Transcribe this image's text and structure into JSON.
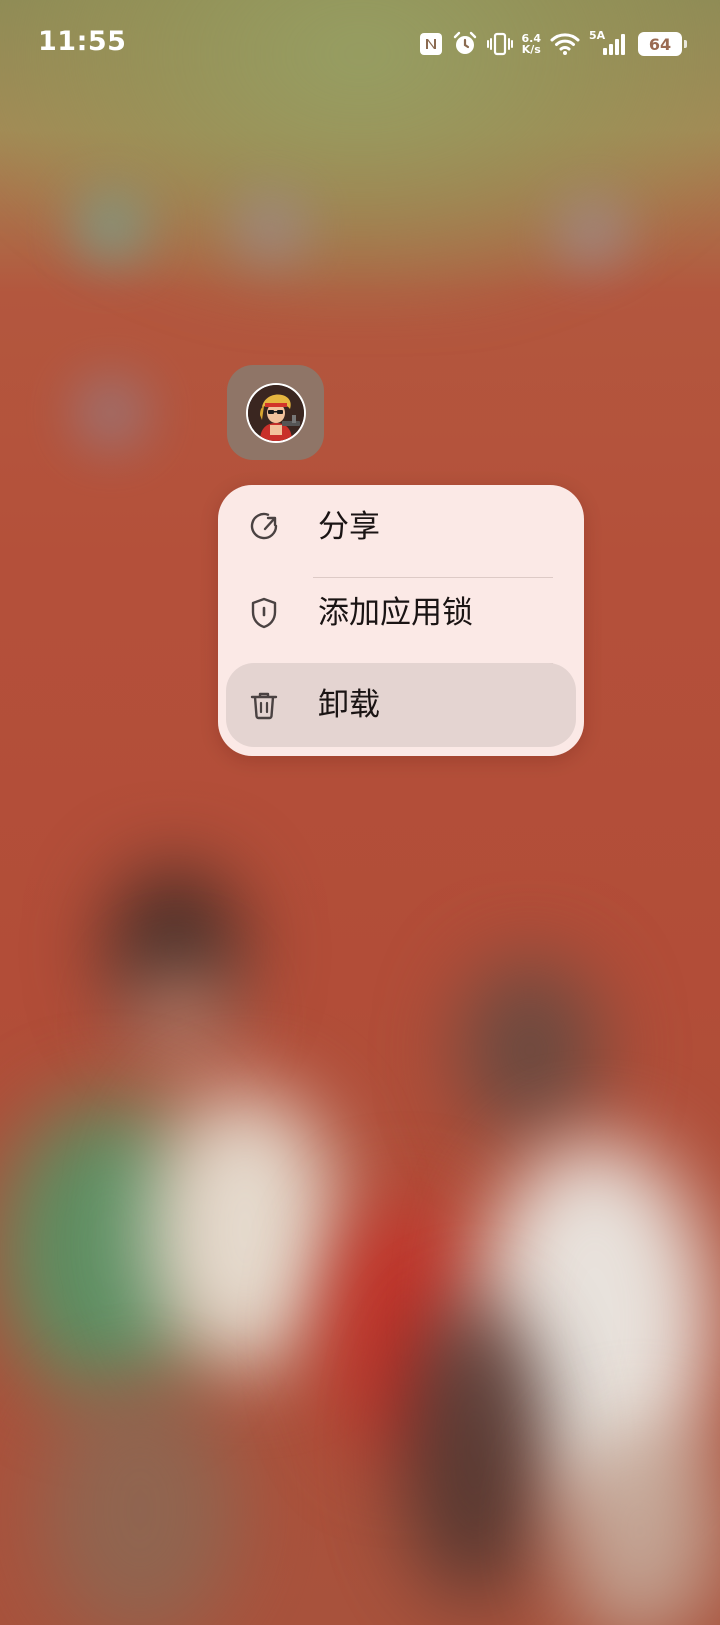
{
  "status_bar": {
    "time": "11:55",
    "nfc_icon": "nfc-icon",
    "alarm_icon": "alarm-icon",
    "vibrate_icon": "vibrate-icon",
    "net_speed_value": "6.4",
    "net_speed_unit": "K/s",
    "wifi_icon": "wifi-icon",
    "network_type": "5A",
    "signal_icon": "signal-icon",
    "battery_level": "64"
  },
  "app": {
    "icon": "game-character-icon"
  },
  "context_menu": {
    "items": [
      {
        "label": "分享",
        "icon": "share-icon",
        "active": false
      },
      {
        "label": "添加应用锁",
        "icon": "shield-icon",
        "active": false
      },
      {
        "label": "卸载",
        "icon": "trash-icon",
        "active": true
      }
    ]
  },
  "colors": {
    "menu_background": "#fbe9e6",
    "menu_active": "#e4d4d1",
    "wallpaper": "#b0503a",
    "icon_frame": "#8f7567"
  }
}
